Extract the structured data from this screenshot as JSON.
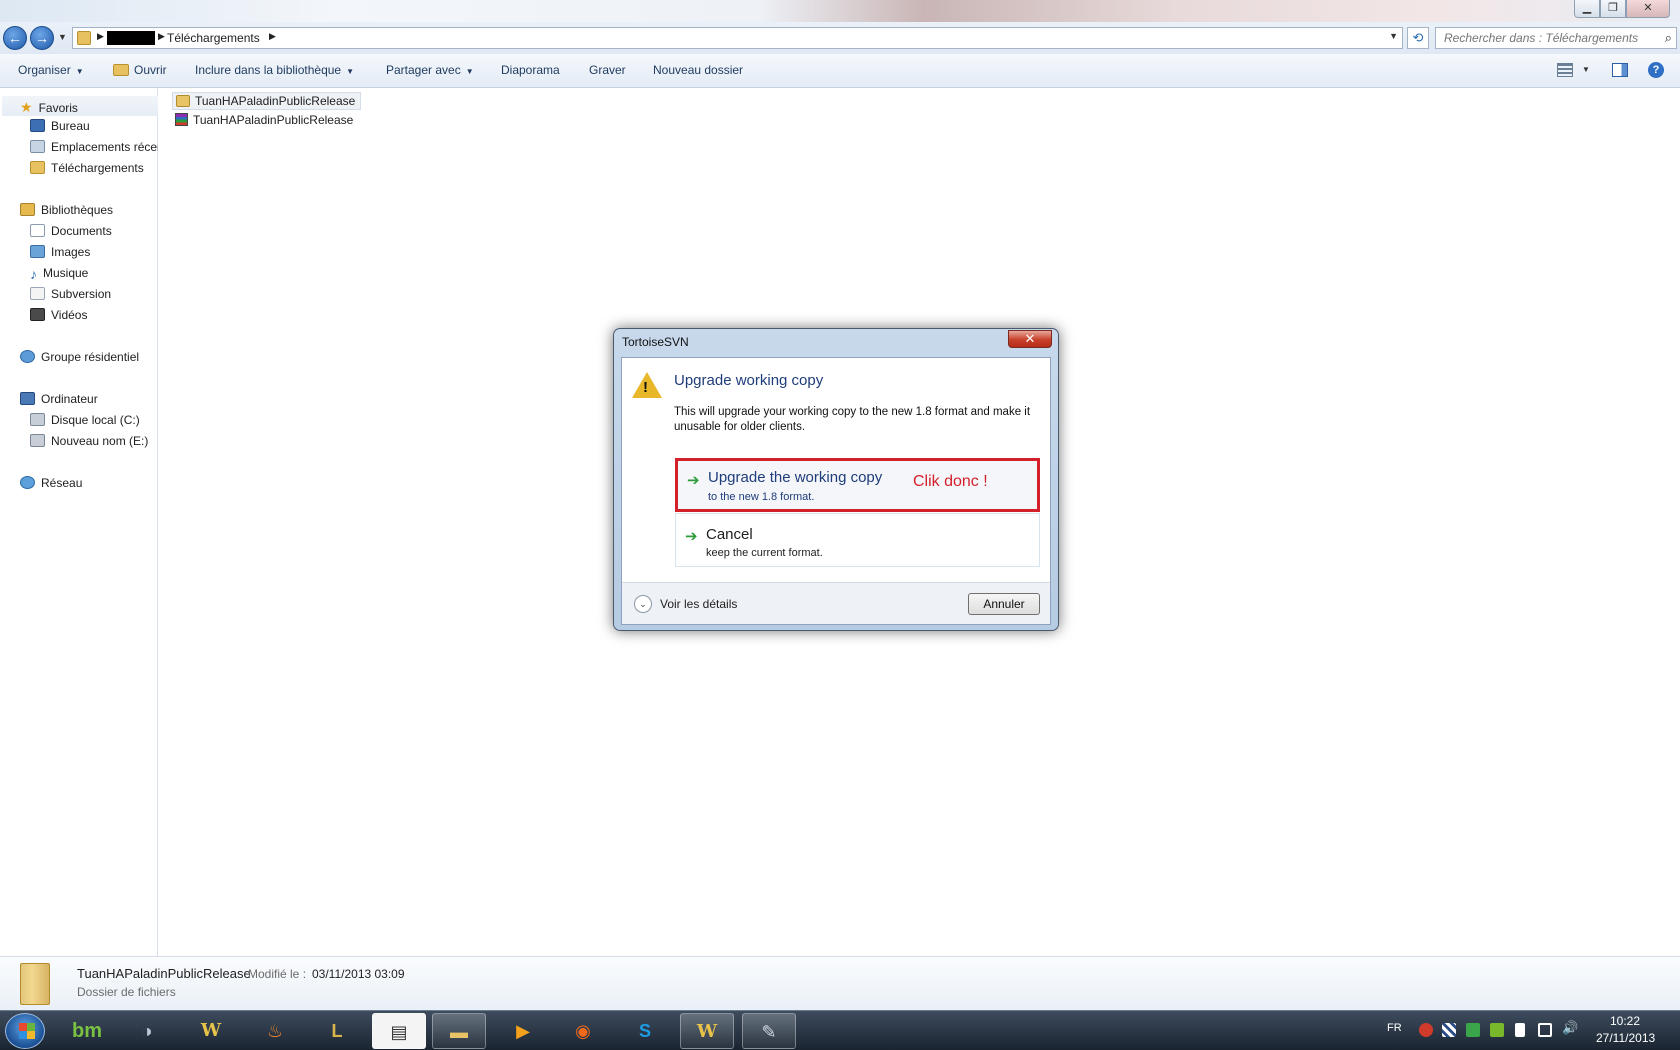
{
  "window": {
    "title": "",
    "controls": {
      "minimize_icon": "minimize-icon",
      "maximize_icon": "maximize-icon",
      "close_icon": "close-icon"
    }
  },
  "address": {
    "crumb": "Téléchargements",
    "search_placeholder": "Rechercher dans : Téléchargements"
  },
  "commandbar": {
    "organize": "Organiser",
    "open": "Ouvrir",
    "include_library": "Inclure dans la bibliothèque",
    "share_with": "Partager avec",
    "slideshow": "Diaporama",
    "burn": "Graver",
    "new_folder": "Nouveau dossier"
  },
  "nav": {
    "favorites": "Favoris",
    "desktop": "Bureau",
    "recent": "Emplacements récents",
    "downloads": "Téléchargements",
    "libraries": "Bibliothèques",
    "documents": "Documents",
    "images": "Images",
    "music": "Musique",
    "subversion": "Subversion",
    "videos": "Vidéos",
    "homegroup": "Groupe résidentiel",
    "computer": "Ordinateur",
    "disk_c": "Disque local (C:)",
    "disk_e": "Nouveau nom (E:)",
    "network": "Réseau"
  },
  "files": [
    {
      "name": "TuanHAPaladinPublicRelease",
      "type": "folder"
    },
    {
      "name": "TuanHAPaladinPublicRelease",
      "type": "rar-archive"
    }
  ],
  "dialog": {
    "title": "TortoiseSVN",
    "heading": "Upgrade working copy",
    "description": "This will upgrade your working copy to the new 1.8 format and make it unusable for older clients.",
    "upgrade_title": "Upgrade the working copy",
    "upgrade_sub": "to the new 1.8 format.",
    "annotation": "Clik donc !",
    "annotation_color": "#d4202a",
    "cancel_title": "Cancel",
    "cancel_sub": "keep the current format.",
    "details_label": "Voir les détails",
    "cancel_button": "Annuler",
    "close_glyph": "✕",
    "warning_glyph": "!"
  },
  "details_pane": {
    "name": "TuanHAPaladinPublicRelease",
    "modified_label": "Modifié le :",
    "modified_value": "03/11/2013 03:09",
    "type": "Dossier de fichiers"
  },
  "taskbar": {
    "apps": [
      {
        "icon": "bm-icon",
        "glyph": "bm"
      },
      {
        "icon": "ghost-icon",
        "glyph": "◑"
      },
      {
        "icon": "world-of-warcraft-icon",
        "glyph": "W"
      },
      {
        "icon": "flame-app-icon",
        "glyph": "♨"
      },
      {
        "icon": "league-of-legends-icon",
        "glyph": "L"
      },
      {
        "icon": "notepad-icon",
        "glyph": "▤"
      },
      {
        "icon": "explorer-folder-icon",
        "glyph": "▬"
      },
      {
        "icon": "media-player-icon",
        "glyph": "▶"
      },
      {
        "icon": "firefox-icon",
        "glyph": "◉"
      },
      {
        "icon": "skype-icon",
        "glyph": "S"
      },
      {
        "icon": "world-of-warcraft-icon",
        "glyph": "W"
      },
      {
        "icon": "paint-icon",
        "glyph": "✎"
      }
    ],
    "language": "FR",
    "time": "10:22",
    "date": "27/11/2013"
  },
  "colors": {
    "accent_blue": "#1f3d7a",
    "highlight_red": "#d4202a"
  }
}
